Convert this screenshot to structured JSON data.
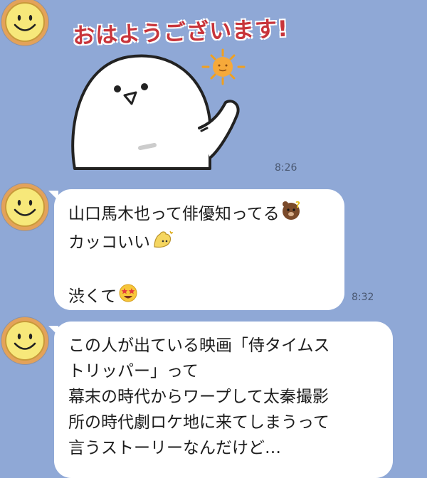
{
  "messages": [
    {
      "type": "sticker",
      "sticker_text": "おはようございます!",
      "time": "8:26"
    },
    {
      "type": "text",
      "lines": [
        "山口馬木也って俳優知ってる",
        "カッコいい",
        "",
        "渋くて"
      ],
      "emojis": [
        "thinking-bear-emoji",
        "flexing-arm-emoji",
        "star-eyes-emoji"
      ],
      "time": "8:32"
    },
    {
      "type": "text",
      "lines": [
        "この人が出ている映画「侍タイムス",
        "トリッパー」って",
        "幕末の時代からワープして太秦撮影",
        "所の時代劇ロケ地に来てしまうって",
        "言うストーリーなんだけど…"
      ]
    }
  ],
  "colors": {
    "background": "#8fa8d6",
    "bubble": "#ffffff",
    "sticker_text": "#c8343a"
  }
}
